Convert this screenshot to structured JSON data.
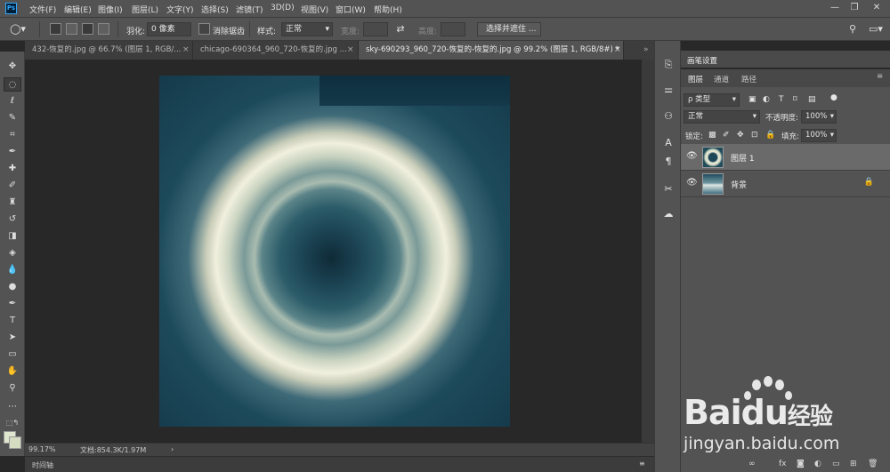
{
  "app": {
    "logo": "Ps"
  },
  "menu": [
    "文件(F)",
    "编辑(E)",
    "图像(I)",
    "图层(L)",
    "文字(Y)",
    "选择(S)",
    "滤镜(T)",
    "3D(D)",
    "视图(V)",
    "窗口(W)",
    "帮助(H)"
  ],
  "window_controls": {
    "minimize": "—",
    "restore": "❐",
    "close": "✕"
  },
  "options": {
    "feather_label": "羽化:",
    "feather_value": "0 像素",
    "antialias_label": "消除锯齿",
    "style_label": "样式:",
    "style_value": "正常",
    "width_label": "宽度:",
    "height_label": "高度:",
    "select_mask_button": "选择并遮住 ..."
  },
  "tabs": [
    {
      "label": "432-恢复的.jpg @ 66.7% (图层 1, RGB/...",
      "close": "×"
    },
    {
      "label": "chicago-690364_960_720-恢复的.jpg ...",
      "close": "×"
    },
    {
      "label": "sky-690293_960_720-恢复的-恢复的.jpg @ 99.2% (图层 1, RGB/8#) *",
      "close": "×"
    }
  ],
  "status": {
    "zoom": "99.17%",
    "doc": "文档:854.3K/1.97M",
    "arrow": "›"
  },
  "timeline": {
    "label": "时间轴"
  },
  "panels": {
    "brush_settings": "画笔设置",
    "tabs": [
      "图层",
      "通道",
      "路径"
    ],
    "filter_kind": "ρ 类型",
    "blend_mode": "正常",
    "opacity_label": "不透明度:",
    "opacity_value": "100%",
    "lock_label": "锁定:",
    "fill_label": "填充:",
    "fill_value": "100%"
  },
  "layers": [
    {
      "name": "图层 1",
      "selected": true,
      "locked": false
    },
    {
      "name": "背景",
      "selected": false,
      "locked": true
    }
  ],
  "watermark": {
    "text1": "Bai",
    "text2": "du",
    "text3": "经验",
    "url": "jingyan.baidu.com"
  },
  "colors": {
    "accent": "#31a8ff",
    "chrome": "#535353",
    "panel_dark": "#3d3d3d"
  }
}
